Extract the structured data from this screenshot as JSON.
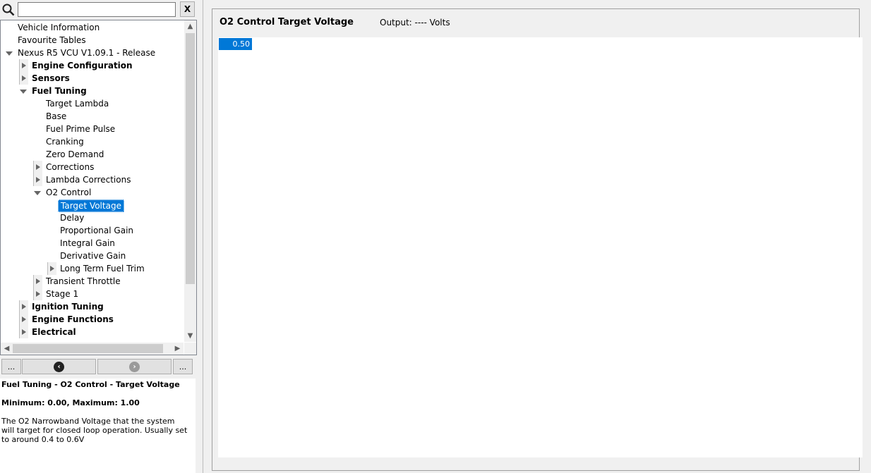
{
  "search": {
    "value": "",
    "placeholder": "",
    "clear_label": "X"
  },
  "tree": [
    {
      "label": "Vehicle Information",
      "level": 0,
      "arrow": "none",
      "bold": false
    },
    {
      "label": "Favourite Tables",
      "level": 0,
      "arrow": "none",
      "bold": false
    },
    {
      "label": "Nexus R5 VCU V1.09.1 - Release",
      "level": 0,
      "arrow": "down",
      "bold": false
    },
    {
      "label": "Engine Configuration",
      "level": 1,
      "arrow": "right",
      "bold": true
    },
    {
      "label": "Sensors",
      "level": 1,
      "arrow": "right",
      "bold": true
    },
    {
      "label": "Fuel Tuning",
      "level": 1,
      "arrow": "down",
      "bold": true
    },
    {
      "label": "Target Lambda",
      "level": 2,
      "arrow": "none",
      "bold": false
    },
    {
      "label": "Base",
      "level": 2,
      "arrow": "none",
      "bold": false
    },
    {
      "label": "Fuel Prime Pulse",
      "level": 2,
      "arrow": "none",
      "bold": false
    },
    {
      "label": "Cranking",
      "level": 2,
      "arrow": "none",
      "bold": false
    },
    {
      "label": "Zero Demand",
      "level": 2,
      "arrow": "none",
      "bold": false
    },
    {
      "label": "Corrections",
      "level": 2,
      "arrow": "right",
      "bold": false
    },
    {
      "label": "Lambda Corrections",
      "level": 2,
      "arrow": "right",
      "bold": false
    },
    {
      "label": "O2 Control",
      "level": 2,
      "arrow": "down",
      "bold": false
    },
    {
      "label": "Target Voltage",
      "level": 3,
      "arrow": "none",
      "bold": false,
      "selected": true
    },
    {
      "label": "Delay",
      "level": 3,
      "arrow": "none",
      "bold": false
    },
    {
      "label": "Proportional Gain",
      "level": 3,
      "arrow": "none",
      "bold": false
    },
    {
      "label": "Integral Gain",
      "level": 3,
      "arrow": "none",
      "bold": false
    },
    {
      "label": "Derivative Gain",
      "level": 3,
      "arrow": "none",
      "bold": false
    },
    {
      "label": "Long Term Fuel Trim",
      "level": 3,
      "arrow": "right",
      "bold": false
    },
    {
      "label": "Transient Throttle",
      "level": 2,
      "arrow": "right",
      "bold": false
    },
    {
      "label": "Stage 1",
      "level": 2,
      "arrow": "right",
      "bold": false
    },
    {
      "label": "Ignition Tuning",
      "level": 1,
      "arrow": "right",
      "bold": true
    },
    {
      "label": "Engine Functions",
      "level": 1,
      "arrow": "right",
      "bold": true
    },
    {
      "label": "Electrical",
      "level": 1,
      "arrow": "right",
      "bold": true
    }
  ],
  "nav": {
    "more_left": "...",
    "more_right": "...",
    "back_icon": "chevron-left-circle-icon",
    "forward_icon": "chevron-right-circle-icon"
  },
  "description": {
    "title": "Fuel Tuning - O2 Control - Target Voltage",
    "range": "Minimum: 0.00, Maximum: 1.00",
    "text": "The O2 Narrowband Voltage that the system will target for closed loop operation. Usually set to around 0.4 to 0.6V"
  },
  "table": {
    "title": "O2 Control Target Voltage",
    "output": "Output: ---- Volts",
    "value": "0.50"
  },
  "colors": {
    "selection": "#0078d7"
  }
}
